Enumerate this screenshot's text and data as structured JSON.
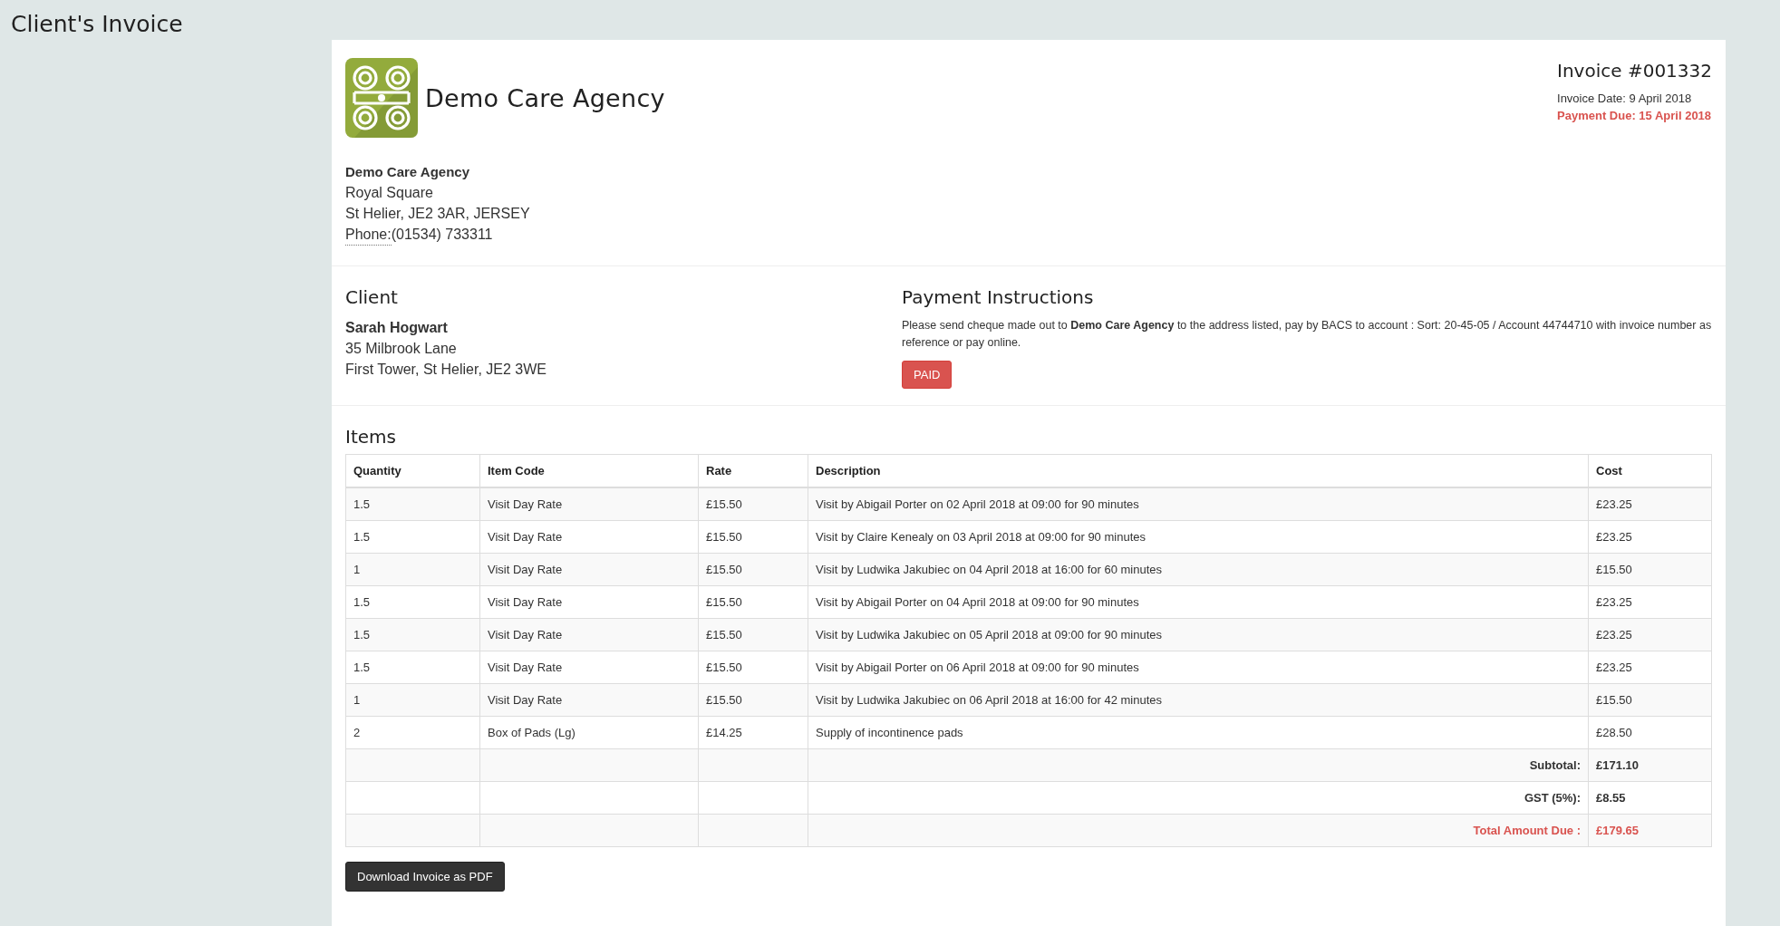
{
  "page_title": "Client's Invoice",
  "agency": {
    "logo_name": "Demo Care Agency",
    "name": "Demo Care Agency",
    "address_lines": [
      "Royal Square",
      "St Helier, JE2 3AR, JERSEY"
    ],
    "phone_label": "Phone:",
    "phone": "(01534) 733311"
  },
  "invoice": {
    "number": "Invoice #001332",
    "date": "Invoice Date: 9 April 2018",
    "due": "Payment Due: 15 April 2018"
  },
  "client": {
    "heading": "Client",
    "name": "Sarah Hogwart",
    "address_lines": [
      "35 Milbrook Lane",
      "First Tower, St Helier, JE2 3WE"
    ]
  },
  "payment": {
    "heading": "Payment Instructions",
    "text": "Please send cheque made out to **Demo Care Agency** to the address listed, pay by BACS to account : Sort: 20-45-05 / Account 44744710 with invoice number as reference or pay online.",
    "status": "PAID"
  },
  "items": {
    "heading": "Items",
    "columns": [
      "Quantity",
      "Item Code",
      "Rate",
      "Description",
      "Cost"
    ],
    "rows": [
      [
        "1.5",
        "Visit Day Rate",
        "£15.50",
        "Visit by Abigail Porter on 02 April 2018 at 09:00 for 90 minutes",
        "£23.25"
      ],
      [
        "1.5",
        "Visit Day Rate",
        "£15.50",
        "Visit by Claire Kenealy on 03 April 2018 at 09:00 for 90 minutes",
        "£23.25"
      ],
      [
        "1",
        "Visit Day Rate",
        "£15.50",
        "Visit by Ludwika Jakubiec on 04 April 2018 at 16:00 for 60 minutes",
        "£15.50"
      ],
      [
        "1.5",
        "Visit Day Rate",
        "£15.50",
        "Visit by Abigail Porter on 04 April 2018 at 09:00 for 90 minutes",
        "£23.25"
      ],
      [
        "1.5",
        "Visit Day Rate",
        "£15.50",
        "Visit by Ludwika Jakubiec on 05 April 2018 at 09:00 for 90 minutes",
        "£23.25"
      ],
      [
        "1.5",
        "Visit Day Rate",
        "£15.50",
        "Visit by Abigail Porter on 06 April 2018 at 09:00 for 90 minutes",
        "£23.25"
      ],
      [
        "1",
        "Visit Day Rate",
        "£15.50",
        "Visit by Ludwika Jakubiec on 06 April 2018 at 16:00 for 42 minutes",
        "£15.50"
      ],
      [
        "2",
        "Box of Pads (Lg)",
        "£14.25",
        "Supply of incontinence pads",
        "£28.50"
      ]
    ],
    "totals": [
      {
        "label": "Subtotal:",
        "value": "£171.10",
        "highlighted": false
      },
      {
        "label": "GST (5%):",
        "value": "£8.55",
        "highlighted": false
      },
      {
        "label": "Total Amount Due :",
        "value": "£179.65",
        "highlighted": true
      }
    ]
  },
  "download_button": "Download Invoice as PDF"
}
